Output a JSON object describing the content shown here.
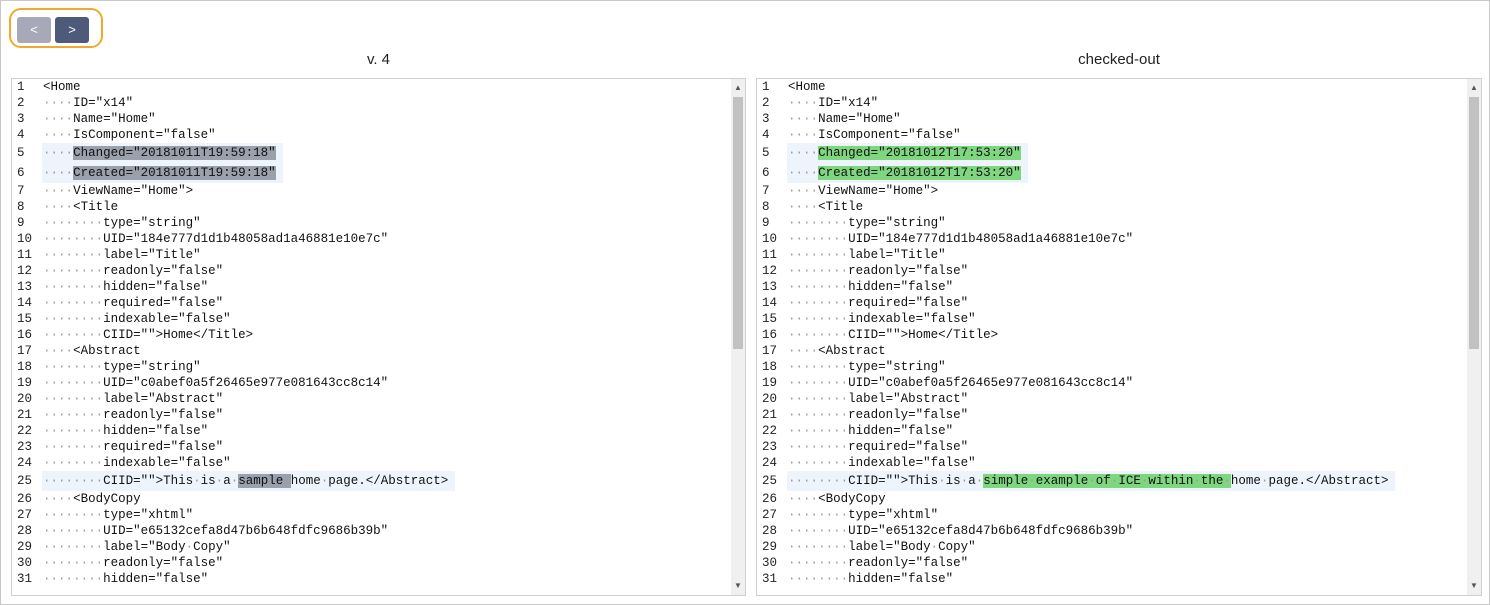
{
  "nav": {
    "prev_label": "<",
    "next_label": ">"
  },
  "panes": [
    {
      "title": "v. 4",
      "mark": "old",
      "lines": [
        {
          "n": "1",
          "text": "<Home"
        },
        {
          "n": "2",
          "text": "····ID=\"x14\""
        },
        {
          "n": "3",
          "text": "····Name=\"Home\""
        },
        {
          "n": "4",
          "text": "····IsComponent=\"false\""
        },
        {
          "n": "5",
          "text": "····Changed=\"20181011T19:59:18\"",
          "changed": true,
          "segs": [
            {
              "t": "····"
            },
            {
              "t": "Changed=\"20181011T19:59:18\"",
              "m": true
            }
          ]
        },
        {
          "n": "6",
          "text": "····Created=\"20181011T19:59:18\"",
          "changed": true,
          "segs": [
            {
              "t": "····"
            },
            {
              "t": "Created=\"20181011T19:59:18\"",
              "m": true
            }
          ]
        },
        {
          "n": "7",
          "text": "····ViewName=\"Home\">"
        },
        {
          "n": "8",
          "text": "····<Title"
        },
        {
          "n": "9",
          "text": "········type=\"string\""
        },
        {
          "n": "10",
          "text": "········UID=\"184e777d1d1b48058ad1a46881e10e7c\""
        },
        {
          "n": "11",
          "text": "········label=\"Title\""
        },
        {
          "n": "12",
          "text": "········readonly=\"false\""
        },
        {
          "n": "13",
          "text": "········hidden=\"false\""
        },
        {
          "n": "14",
          "text": "········required=\"false\""
        },
        {
          "n": "15",
          "text": "········indexable=\"false\""
        },
        {
          "n": "16",
          "text": "········CIID=\"\">Home</Title>"
        },
        {
          "n": "17",
          "text": "····<Abstract"
        },
        {
          "n": "18",
          "text": "········type=\"string\""
        },
        {
          "n": "19",
          "text": "········UID=\"c0abef0a5f26465e977e081643cc8c14\""
        },
        {
          "n": "20",
          "text": "········label=\"Abstract\""
        },
        {
          "n": "21",
          "text": "········readonly=\"false\""
        },
        {
          "n": "22",
          "text": "········hidden=\"false\""
        },
        {
          "n": "23",
          "text": "········required=\"false\""
        },
        {
          "n": "24",
          "text": "········indexable=\"false\""
        },
        {
          "n": "25",
          "text": "········CIID=\"\">This·is·a·sample·home·page.</Abstract>",
          "changed": true,
          "segs": [
            {
              "t": "········CIID=\"\">This·is·a·"
            },
            {
              "t": "sample·",
              "m": true
            },
            {
              "t": "home·page.</Abstract>"
            }
          ]
        },
        {
          "n": "26",
          "text": "····<BodyCopy"
        },
        {
          "n": "27",
          "text": "········type=\"xhtml\""
        },
        {
          "n": "28",
          "text": "········UID=\"e65132cefa8d47b6b648fdfc9686b39b\""
        },
        {
          "n": "29",
          "text": "········label=\"Body·Copy\""
        },
        {
          "n": "30",
          "text": "········readonly=\"false\""
        },
        {
          "n": "31",
          "text": "········hidden=\"false\""
        }
      ]
    },
    {
      "title": "checked-out",
      "mark": "new",
      "lines": [
        {
          "n": "1",
          "text": "<Home"
        },
        {
          "n": "2",
          "text": "····ID=\"x14\""
        },
        {
          "n": "3",
          "text": "····Name=\"Home\""
        },
        {
          "n": "4",
          "text": "····IsComponent=\"false\""
        },
        {
          "n": "5",
          "text": "····Changed=\"20181012T17:53:20\"",
          "changed": true,
          "segs": [
            {
              "t": "····"
            },
            {
              "t": "Changed=\"20181012T17:53:20\"",
              "m": true
            }
          ]
        },
        {
          "n": "6",
          "text": "····Created=\"20181012T17:53:20\"",
          "changed": true,
          "segs": [
            {
              "t": "····"
            },
            {
              "t": "Created=\"20181012T17:53:20\"",
              "m": true
            }
          ]
        },
        {
          "n": "7",
          "text": "····ViewName=\"Home\">"
        },
        {
          "n": "8",
          "text": "····<Title"
        },
        {
          "n": "9",
          "text": "········type=\"string\""
        },
        {
          "n": "10",
          "text": "········UID=\"184e777d1d1b48058ad1a46881e10e7c\""
        },
        {
          "n": "11",
          "text": "········label=\"Title\""
        },
        {
          "n": "12",
          "text": "········readonly=\"false\""
        },
        {
          "n": "13",
          "text": "········hidden=\"false\""
        },
        {
          "n": "14",
          "text": "········required=\"false\""
        },
        {
          "n": "15",
          "text": "········indexable=\"false\""
        },
        {
          "n": "16",
          "text": "········CIID=\"\">Home</Title>"
        },
        {
          "n": "17",
          "text": "····<Abstract"
        },
        {
          "n": "18",
          "text": "········type=\"string\""
        },
        {
          "n": "19",
          "text": "········UID=\"c0abef0a5f26465e977e081643cc8c14\""
        },
        {
          "n": "20",
          "text": "········label=\"Abstract\""
        },
        {
          "n": "21",
          "text": "········readonly=\"false\""
        },
        {
          "n": "22",
          "text": "········hidden=\"false\""
        },
        {
          "n": "23",
          "text": "········required=\"false\""
        },
        {
          "n": "24",
          "text": "········indexable=\"false\""
        },
        {
          "n": "25",
          "text": "········CIID=\"\">This·is·a·simple·example·of·ICE·within·the·home·page.</Abstract>",
          "changed": true,
          "segs": [
            {
              "t": "········CIID=\"\">This·is·a·"
            },
            {
              "t": "simple·example·of·ICE·within·the·",
              "m": true
            },
            {
              "t": "home·page.</Abstract>"
            }
          ]
        },
        {
          "n": "26",
          "text": "····<BodyCopy"
        },
        {
          "n": "27",
          "text": "········type=\"xhtml\""
        },
        {
          "n": "28",
          "text": "········UID=\"e65132cefa8d47b6b648fdfc9686b39b\""
        },
        {
          "n": "29",
          "text": "········label=\"Body·Copy\""
        },
        {
          "n": "30",
          "text": "········readonly=\"false\""
        },
        {
          "n": "31",
          "text": "········hidden=\"false\""
        }
      ]
    }
  ],
  "scroll": {
    "up_icon": "▲",
    "down_icon": "▼"
  },
  "colors": {
    "old_highlight": "#9aa0ac",
    "new_highlight": "#7ed67e",
    "changed_line_bg": "#eef4fb",
    "focus_ring": "#f0a92c"
  }
}
